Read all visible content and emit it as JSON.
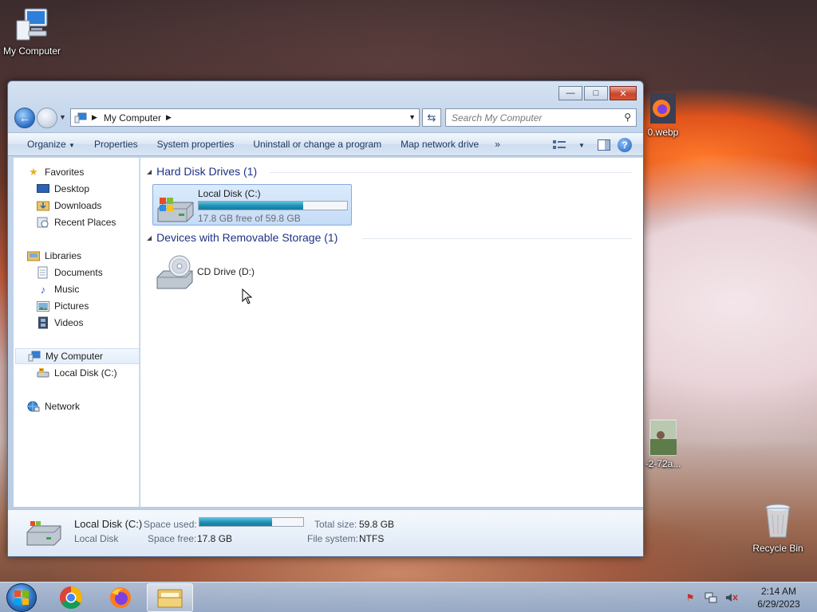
{
  "desktop": {
    "icons": [
      {
        "label": "My Computer",
        "icon": "computer-icon"
      },
      {
        "label": "0.webp",
        "icon": "firefox-file-icon"
      },
      {
        "label": "-2-72a...",
        "icon": "image-file-icon"
      },
      {
        "label": "Recycle Bin",
        "icon": "recycle-bin-icon"
      }
    ]
  },
  "window": {
    "caption_buttons": {
      "minimize": "—",
      "maximize": "□",
      "close": "✕"
    },
    "address": {
      "root_icon": "computer-icon",
      "crumb": "My Computer"
    },
    "search": {
      "placeholder": "Search My Computer"
    },
    "commands": [
      "Organize",
      "Properties",
      "System properties",
      "Uninstall or change a program",
      "Map network drive"
    ],
    "more_commands": "»",
    "nav": {
      "favorites": "Favorites",
      "desktop": "Desktop",
      "downloads": "Downloads",
      "recent": "Recent Places",
      "libraries": "Libraries",
      "documents": "Documents",
      "music": "Music",
      "pictures": "Pictures",
      "videos": "Videos",
      "computer": "My Computer",
      "local_disk": "Local Disk (C:)",
      "network": "Network"
    },
    "groups": {
      "hdd": "Hard Disk Drives (1)",
      "removable": "Devices with Removable Storage (1)"
    },
    "drives": {
      "c": {
        "name": "Local Disk (C:)",
        "meta": "17.8 GB free of 59.8 GB",
        "used_fraction": 0.702
      },
      "d": {
        "name": "CD Drive (D:)"
      }
    },
    "details": {
      "name": "Local Disk (C:)",
      "type": "Local Disk",
      "space_used_label": "Space used:",
      "space_free_label": "Space free:",
      "space_free": "17.8 GB",
      "total_size_label": "Total size:",
      "total_size": "59.8 GB",
      "fs_label": "File system:",
      "fs": "NTFS"
    }
  },
  "taskbar": {
    "clock_time": "2:14 AM",
    "clock_date": "6/29/2023",
    "colors": {
      "accent": "#1c8fb5",
      "link": "#1e3287"
    }
  }
}
